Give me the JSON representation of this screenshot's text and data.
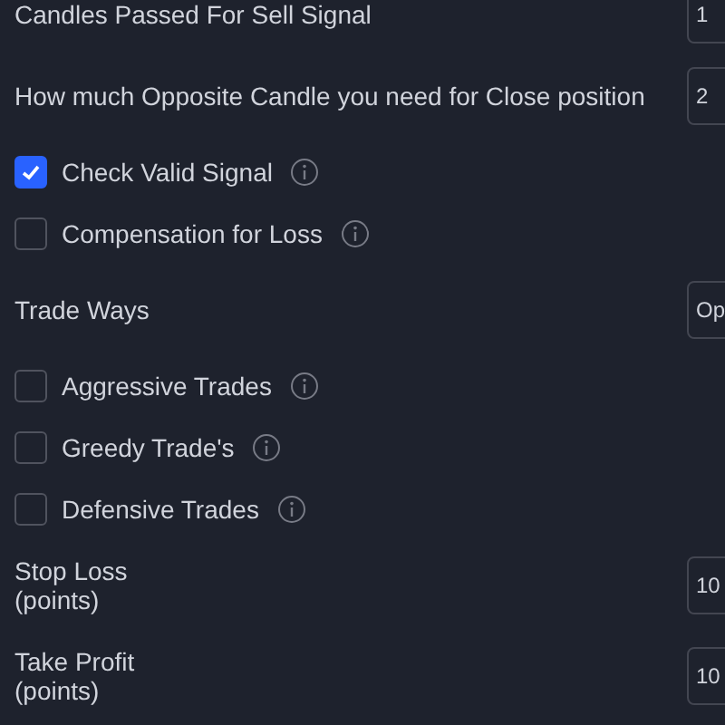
{
  "rows": [
    {
      "kind": "field",
      "label": "Candles Passed For Sell Signal",
      "value": "1"
    },
    {
      "kind": "field",
      "label": "How much Opposite Candle you need for Close position",
      "value": "2"
    },
    {
      "kind": "checkbox",
      "label": "Check Valid Signal",
      "checked": true,
      "info": true
    },
    {
      "kind": "checkbox",
      "label": "Compensation for Loss",
      "checked": false,
      "info": true
    },
    {
      "kind": "field",
      "label": "Trade Ways",
      "value": "Op"
    },
    {
      "kind": "checkbox",
      "label": "Aggressive Trades",
      "checked": false,
      "info": true
    },
    {
      "kind": "checkbox",
      "label": "Greedy Trade's",
      "checked": false,
      "info": true
    },
    {
      "kind": "checkbox",
      "label": "Defensive Trades",
      "checked": false,
      "info": true
    },
    {
      "kind": "field",
      "label": "Stop Loss\n(points)",
      "value": "10"
    },
    {
      "kind": "field",
      "label": "Take Profit\n(points)",
      "value": "10"
    }
  ]
}
